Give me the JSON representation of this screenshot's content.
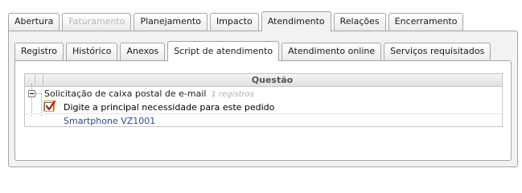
{
  "top_tabs": [
    {
      "label": "Abertura"
    },
    {
      "label": "Faturamento"
    },
    {
      "label": "Planejamento"
    },
    {
      "label": "Impacto"
    },
    {
      "label": "Atendimento"
    },
    {
      "label": "Relações"
    },
    {
      "label": "Encerramento"
    }
  ],
  "sub_tabs": [
    {
      "label": "Registro"
    },
    {
      "label": "Histórico"
    },
    {
      "label": "Anexos"
    },
    {
      "label": "Script de atendimento"
    },
    {
      "label": "Atendimento online"
    },
    {
      "label": "Serviços requisitados"
    }
  ],
  "grid": {
    "column_title": "Questão",
    "group": {
      "label": "Solicitação de caixa postal de e-mail",
      "count": "1 registros"
    },
    "question": "Digite a principal necessidade para este pedido",
    "answer": "Smartphone VZ1001"
  }
}
